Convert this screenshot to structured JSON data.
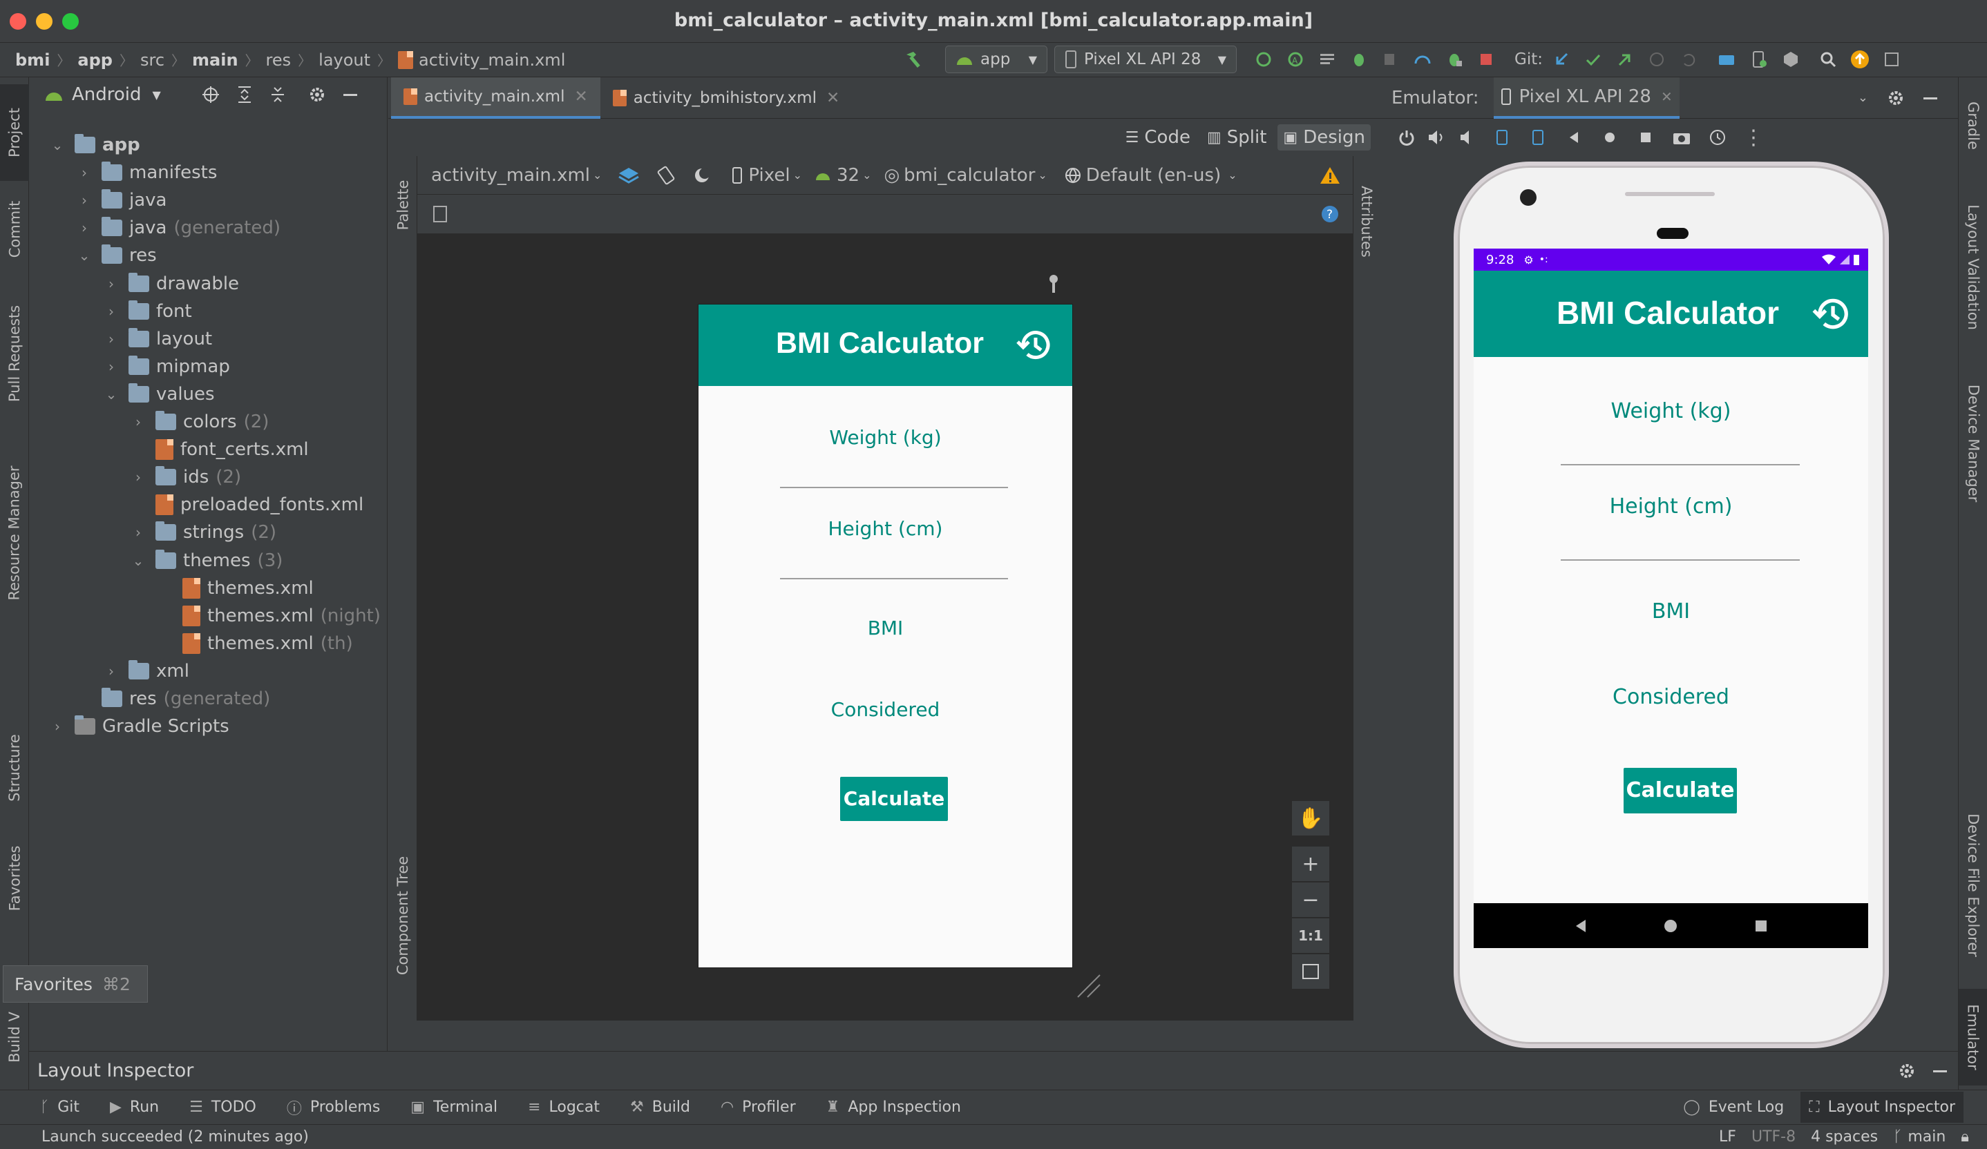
{
  "window": {
    "title": "bmi_calculator – activity_main.xml [bmi_calculator.app.main]"
  },
  "breadcrumb": [
    "bmi",
    "app",
    "src",
    "main",
    "res",
    "layout",
    "activity_main.xml"
  ],
  "toolbar": {
    "run_config": "app",
    "device": "Pixel XL API 28",
    "git_label": "Git:"
  },
  "left_tabs": [
    "Project",
    "Commit",
    "Pull Requests",
    "Resource Manager",
    "Structure",
    "Favorites",
    "Build V"
  ],
  "right_tabs": [
    "Gradle",
    "Layout Validation",
    "Device Manager",
    "Device File Explorer",
    "Emulator"
  ],
  "project": {
    "view": "Android",
    "tree": [
      {
        "label": "app",
        "sec": "",
        "type": "module"
      },
      {
        "label": "manifests",
        "sec": "",
        "type": "folder"
      },
      {
        "label": "java",
        "sec": "",
        "type": "folder"
      },
      {
        "label": "java",
        "sec": "(generated)",
        "type": "folder"
      },
      {
        "label": "res",
        "sec": "",
        "type": "folder"
      },
      {
        "label": "drawable",
        "sec": "",
        "type": "folder"
      },
      {
        "label": "font",
        "sec": "",
        "type": "folder"
      },
      {
        "label": "layout",
        "sec": "",
        "type": "folder"
      },
      {
        "label": "mipmap",
        "sec": "",
        "type": "folder"
      },
      {
        "label": "values",
        "sec": "",
        "type": "folder"
      },
      {
        "label": "colors",
        "sec": "(2)",
        "type": "folder"
      },
      {
        "label": "font_certs.xml",
        "sec": "",
        "type": "xml"
      },
      {
        "label": "ids",
        "sec": "(2)",
        "type": "folder"
      },
      {
        "label": "preloaded_fonts.xml",
        "sec": "",
        "type": "xml"
      },
      {
        "label": "strings",
        "sec": "(2)",
        "type": "folder"
      },
      {
        "label": "themes",
        "sec": "(3)",
        "type": "folder"
      },
      {
        "label": "themes.xml",
        "sec": "",
        "type": "xml"
      },
      {
        "label": "themes.xml",
        "sec": "(night)",
        "type": "xml"
      },
      {
        "label": "themes.xml",
        "sec": "(th)",
        "type": "xml"
      },
      {
        "label": "xml",
        "sec": "",
        "type": "folder"
      },
      {
        "label": "res",
        "sec": "(generated)",
        "type": "folder"
      },
      {
        "label": "Gradle Scripts",
        "sec": "",
        "type": "gradle"
      }
    ]
  },
  "favorites_tip": {
    "label": "Favorites",
    "shortcut": "⌘2"
  },
  "editor": {
    "tabs": [
      "activity_main.xml",
      "activity_bmihistory.xml"
    ],
    "modes": [
      "Code",
      "Split",
      "Design"
    ],
    "design_toolbar": {
      "file": "activity_main.xml",
      "device": "Pixel",
      "api": "32",
      "theme": "bmi_calculator",
      "locale": "Default (en-us)"
    },
    "palette_label": "Palette",
    "component_tree_label": "Component Tree",
    "attributes_label": "Attributes",
    "zoom_fit_label": "1:1"
  },
  "app_preview": {
    "title": "BMI Calculator",
    "weight_label": "Weight (kg)",
    "height_label": "Height (cm)",
    "bmi_label": "BMI",
    "considered_label": "Considered",
    "calculate_label": "Calculate"
  },
  "emulator": {
    "label": "Emulator:",
    "device_tab": "Pixel XL API 28",
    "status_time": "9:28"
  },
  "bottom": {
    "panel_title": "Layout Inspector",
    "tool_windows": [
      "Git",
      "Run",
      "TODO",
      "Problems",
      "Terminal",
      "Logcat",
      "Build",
      "Profiler",
      "App Inspection"
    ],
    "right_tools": [
      "Event Log",
      "Layout Inspector"
    ],
    "status_message": "Launch succeeded (2 minutes ago)",
    "status_right": [
      "LF",
      "UTF-8",
      "4 spaces",
      "main"
    ]
  },
  "colors": {
    "accent": "#009688",
    "teal_text": "#00897b",
    "ide_bg": "#3c3f41",
    "canvas_bg": "#2b2b2b",
    "status_bar": "#6200ee"
  }
}
